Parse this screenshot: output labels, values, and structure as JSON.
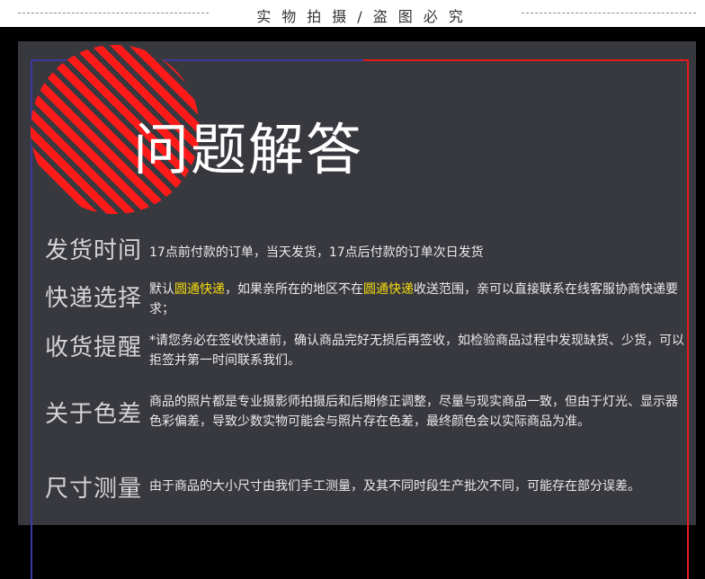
{
  "banner": {
    "title": "实物拍摄/盗图必究"
  },
  "heading": "问题解答",
  "faq": [
    {
      "label": "发货时间",
      "parts": [
        "17点前付款的订单，当天发货，17点后付款的订单次日发货"
      ]
    },
    {
      "label": "快递选择",
      "parts": [
        "默认",
        "圆通快递",
        "，如果亲所在的地区不在",
        "圆通快递",
        "收送范围，亲可以直接联系在线客服协商快递要求；"
      ]
    },
    {
      "label": "收货提醒",
      "parts": [
        "*请您务必在签收快递前，确认商品完好无损后再签收，如检验商品过程中发现缺货、少货，可以拒签并第一时间联系我们。"
      ]
    },
    {
      "label": "关于色差",
      "parts": [
        "商品的照片都是专业摄影师拍摄后和后期修正调整，尽量与现实商品一致，但由于灯光、显示器色彩偏差，导致少数实物可能会与照片存在色差，最终颜色会以实际商品为准。"
      ]
    },
    {
      "label": "尺寸测量",
      "parts": [
        "由于商品的大小尺寸由我们手工测量，及其不同时段生产批次不同，可能存在部分误差。"
      ]
    }
  ],
  "colors": {
    "accent_red": "#e51b1b",
    "accent_blue": "#3b3aa0",
    "highlight": "#f5dc0e",
    "panel": "#38383f"
  }
}
